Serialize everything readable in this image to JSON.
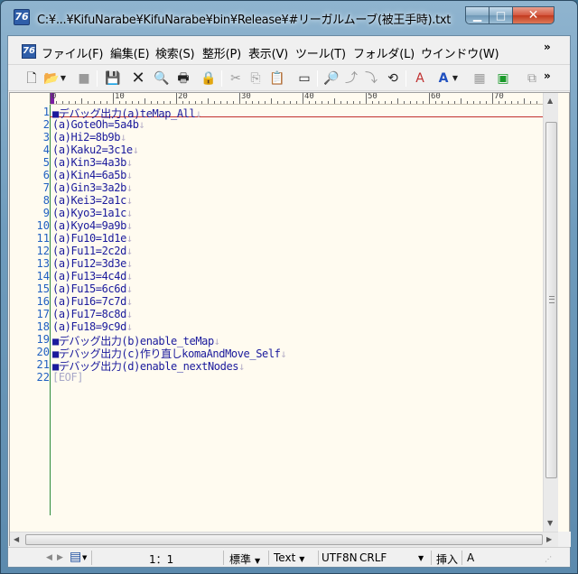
{
  "window": {
    "title": "C:¥...¥KifuNarabe¥KifuNarabe¥bin¥Release¥#リーガルムーブ(被王手時).txt",
    "app_icon_glyph": "76"
  },
  "menu": {
    "items": [
      "ファイル(F)",
      "編集(E)",
      "検索(S)",
      "整形(P)",
      "表示(V)",
      "ツール(T)",
      "フォルダ(L)",
      "ウインドウ(W)"
    ],
    "overflow": "»"
  },
  "ruler": {
    "marks": [
      "0",
      "10",
      "20",
      "30",
      "40",
      "50",
      "60",
      "70"
    ]
  },
  "editor": {
    "lines": [
      "■デバッグ出力(a)teMap_All",
      "(a)GoteOh=5a4b",
      "(a)Hi2=8b9b",
      "(a)Kaku2=3c1e",
      "(a)Kin3=4a3b",
      "(a)Kin4=6a5b",
      "(a)Gin3=3a2b",
      "(a)Kei3=2a1c",
      "(a)Kyo3=1a1c",
      "(a)Kyo4=9a9b",
      "(a)Fu10=1d1e",
      "(a)Fu11=2c2d",
      "(a)Fu12=3d3e",
      "(a)Fu13=4c4d",
      "(a)Fu15=6c6d",
      "(a)Fu16=7c7d",
      "(a)Fu17=8c8d",
      "(a)Fu18=9c9d",
      "■デバッグ出力(b)enable_teMap",
      "■デバッグ出力(c)作り直しkomaAndMove_Self",
      "■デバッグ出力(d)enable_nextNodes"
    ],
    "newline_mark": "↓",
    "eof_marker": "[EOF]",
    "line_numbers": [
      "1",
      "2",
      "3",
      "4",
      "5",
      "6",
      "7",
      "8",
      "9",
      "10",
      "11",
      "12",
      "13",
      "14",
      "15",
      "16",
      "17",
      "18",
      "19",
      "20",
      "21",
      "22"
    ]
  },
  "statusbar": {
    "position": "1：1",
    "mode": "標準",
    "type": "Text",
    "encoding": "UTF8N",
    "line_ending": "CRLF",
    "insert_mode": "挿入",
    "ime": "A"
  },
  "colors": {
    "editor_bg": "#fffbf0",
    "text": "#1a1a9c",
    "line_number": "#2060c0",
    "gutter_line": "#2e8b3a",
    "cursor_line": "#c03030"
  }
}
